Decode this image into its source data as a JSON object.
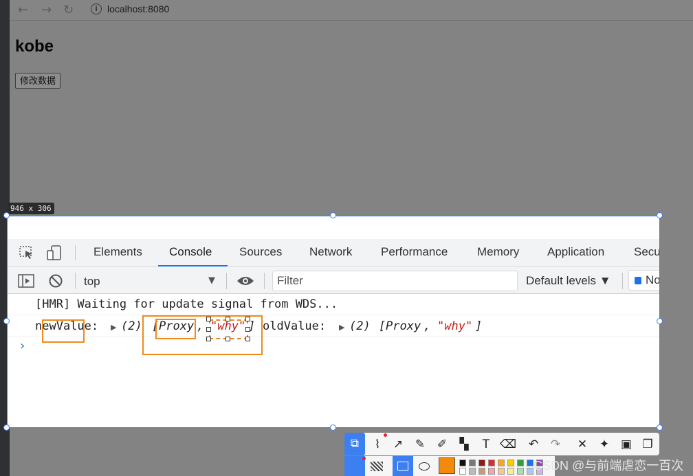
{
  "browser": {
    "url": "localhost:8080",
    "page_heading": "kobe",
    "page_button": "修改数据"
  },
  "size_label": "946 x 306",
  "devtools": {
    "tabs": [
      "Elements",
      "Console",
      "Sources",
      "Network",
      "Performance",
      "Memory",
      "Application",
      "Security"
    ],
    "active_tab": "Console",
    "context": "top",
    "filter_placeholder": "Filter",
    "levels": "Default levels ▼",
    "issues": "No Issues"
  },
  "console": {
    "line1": "[HMR] Waiting for update signal from WDS...",
    "line2": {
      "label_new": "newValue:",
      "count_new": "(2)",
      "open_new": "[",
      "proxy_new": "Proxy",
      "comma_new": ",",
      "why_new": "\"why\"",
      "close_new": "]",
      "label_old": "oldValue:",
      "count_old": "(2)",
      "open_old": "[",
      "proxy_old": "Proxy",
      "comma_old": ",",
      "why_old": "\"why\"",
      "close_old": "]"
    },
    "prompt": "›"
  },
  "accent_color": "#f08a1c",
  "selection_color": "#3c7ff0",
  "watermark": "CSDN @与前端虐恋一百次"
}
